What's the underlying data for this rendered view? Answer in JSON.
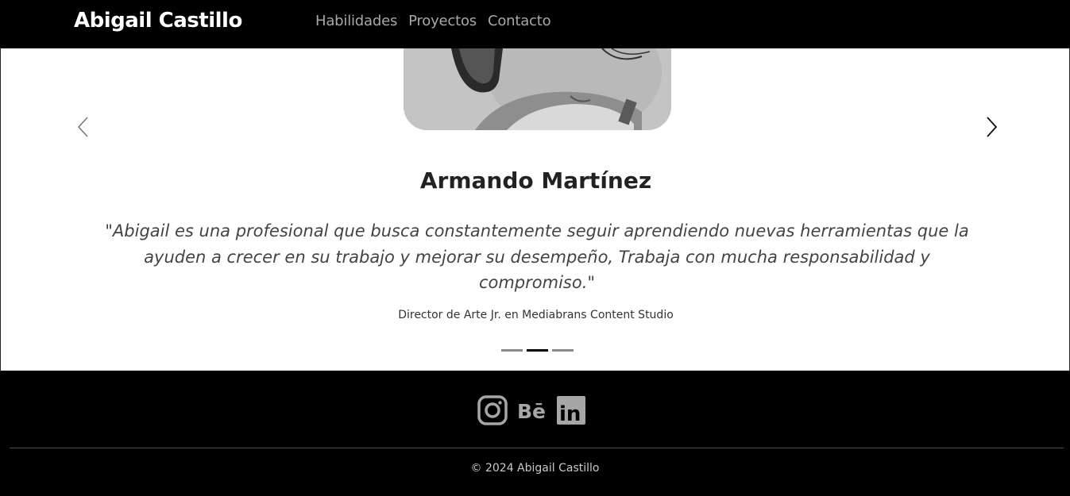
{
  "nav": {
    "brand": "Abigail Castillo",
    "links": [
      "Habilidades",
      "Proyectos",
      "Contacto"
    ]
  },
  "testimonial": {
    "name": "Armando Martínez",
    "quote": "\"Abigail es una profesional que busca constantemente seguir aprendiendo nuevas herramientas que la ayuden a crecer en su trabajo y mejorar su desempeño, Trabaja con mucha responsabilidad y compromiso.\"",
    "role": "Director de Arte Jr. en Mediabrans Content Studio",
    "prev_icon": "chevron-left-icon",
    "next_icon": "chevron-right-icon",
    "slides_total": 3,
    "active_slide": 2
  },
  "footer": {
    "social": [
      {
        "icon": "instagram-icon"
      },
      {
        "icon": "behance-icon",
        "glyph": "Bē"
      },
      {
        "icon": "linkedin-icon",
        "glyph": "in"
      }
    ],
    "copyright": "© 2024 Abigail Castillo"
  },
  "colors": {
    "nav_bg": "#000000",
    "nav_link": "#a8a8a8",
    "section_bg": "#ffffff",
    "icon_gray": "#a6a6a6"
  }
}
